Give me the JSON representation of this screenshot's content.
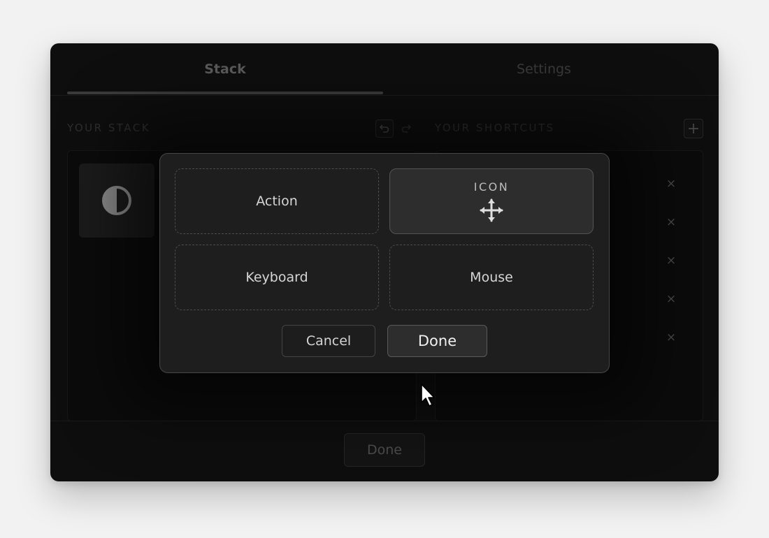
{
  "tabs": [
    {
      "label": "Stack",
      "active": true
    },
    {
      "label": "Settings",
      "active": false
    }
  ],
  "stack": {
    "title": "YOUR STACK",
    "undo_icon": "undo-icon",
    "redo_icon": "redo-icon",
    "tile_icon": "contrast-icon"
  },
  "shortcuts": {
    "title": "YOUR SHORTCUTS",
    "add_label": "+",
    "remove_label": "×"
  },
  "footer": {
    "done_label": "Done"
  },
  "modal": {
    "slots": {
      "action": "Action",
      "icon_label": "ICON",
      "icon_glyph": "move-icon",
      "keyboard": "Keyboard",
      "mouse": "Mouse"
    },
    "cancel_label": "Cancel",
    "done_label": "Done"
  },
  "colors": {
    "background": "#f2f2f2",
    "window": "#0e0e0e",
    "modal": "#1e1e1e",
    "accent_button": "#2d2d2d"
  }
}
